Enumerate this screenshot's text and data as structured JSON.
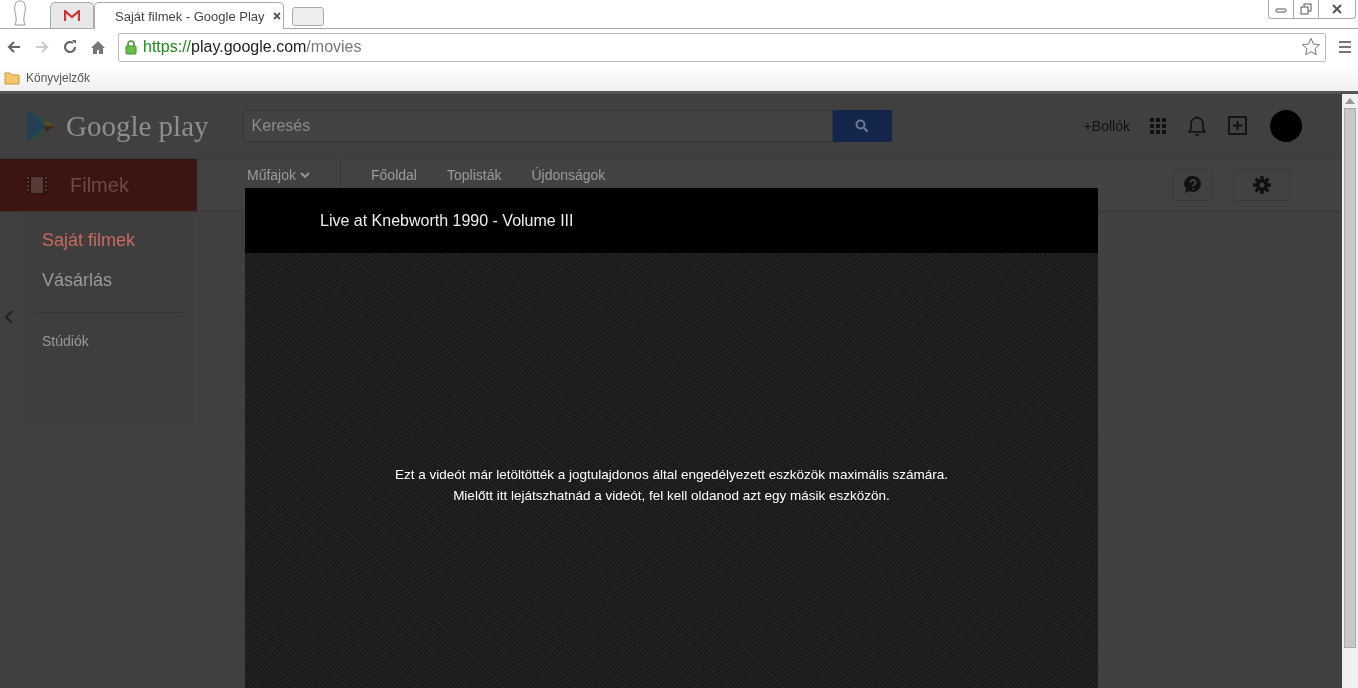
{
  "browser": {
    "tabs": [
      {
        "kind": "mail",
        "selected": false
      },
      {
        "kind": "page",
        "title": "Saját filmek - Google Play",
        "selected": true
      }
    ],
    "address": {
      "scheme": "https://",
      "host": "play.google.com",
      "path": "/movies"
    },
    "bookmarks": [
      {
        "label": "Könyvjelzők"
      }
    ]
  },
  "header": {
    "logo": "Google play",
    "search": {
      "placeholder": "Keresés"
    },
    "profile_link": "+Bollók"
  },
  "category": {
    "label": "Filmek"
  },
  "nav": [
    {
      "label": "Műfajok",
      "kind": "dropdown"
    },
    {
      "label": "Főoldal",
      "kind": "link"
    },
    {
      "label": "Toplisták",
      "kind": "link"
    },
    {
      "label": "Újdonságok",
      "kind": "link"
    }
  ],
  "sidebar": {
    "items": [
      {
        "label": "Saját filmek",
        "selected": true
      },
      {
        "label": "Vásárlás",
        "selected": false
      }
    ],
    "secondary": [
      {
        "label": "Stúdiók"
      }
    ]
  },
  "player": {
    "title": "Live at Knebworth 1990 - Volume III",
    "message_lines": [
      "Ezt a videót már letöltötték a jogtulajdonos által engedélyezett eszközök maximális számára.",
      "Mielőtt itt lejátszhatnád a videót, fel kell oldanod azt egy másik eszközön."
    ]
  }
}
